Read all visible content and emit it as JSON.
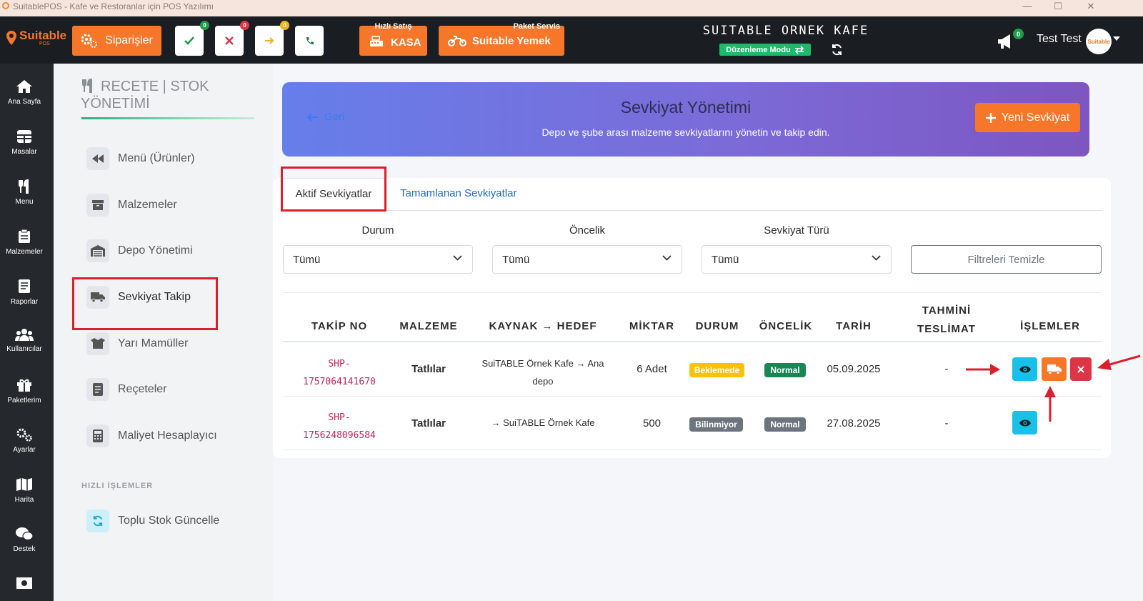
{
  "window": {
    "title": "SuitablePOS - Kafe ve Restoranlar için POS Yazılımı",
    "controls": [
      "—",
      "☐",
      "✕"
    ]
  },
  "topbar": {
    "logo_text": "Suitable",
    "logo_sub": "POS",
    "orders_label": "Siparişler",
    "status_buttons": [
      {
        "name": "approved",
        "badge": "0",
        "badge_color": "#1e9e4a",
        "icon_color": "#1e9e4a"
      },
      {
        "name": "cancelled",
        "badge": "0",
        "badge_color": "#dc3545",
        "icon_color": "#dc3545"
      },
      {
        "name": "forwarded",
        "badge": "0",
        "badge_color": "#f0b323",
        "icon_color": "#f0b323"
      },
      {
        "name": "phone",
        "badge": "",
        "badge_color": "",
        "icon_color": "#1e7b4a"
      }
    ],
    "quick_sale_label": "Hızlı Satış",
    "kasa_label": "KASA",
    "package_label": "Paket Servis",
    "suitable_yemek_label": "Suitable Yemek",
    "cafe_name": "SUITABLE ORNEK KAFE",
    "mode_label": "Düzenleme Modu",
    "notification_count": "0",
    "user_name": "Test Test",
    "avatar_text": "Suitable"
  },
  "sidebar": {
    "items": [
      {
        "label": "Ana Sayfa",
        "icon": "home-icon"
      },
      {
        "label": "Masalar",
        "icon": "table-icon"
      },
      {
        "label": "Menu",
        "icon": "utensils-icon"
      },
      {
        "label": "Malzemeler",
        "icon": "clipboard-icon"
      },
      {
        "label": "Raporlar",
        "icon": "report-icon"
      },
      {
        "label": "Kullanıcılar",
        "icon": "users-icon"
      },
      {
        "label": "Paketlerim",
        "icon": "gift-icon"
      },
      {
        "label": "Ayarlar",
        "icon": "gears-icon"
      },
      {
        "label": "Harita",
        "icon": "map-icon"
      },
      {
        "label": "Destek",
        "icon": "chat-icon"
      }
    ]
  },
  "left_panel": {
    "title_line1": "RECETE | STOK",
    "title_line2": "YÖNETİMİ",
    "items": [
      {
        "label": "Menü (Ürünler)",
        "icon": "backward-icon"
      },
      {
        "label": "Malzemeler",
        "icon": "box-icon"
      },
      {
        "label": "Depo Yönetimi",
        "icon": "warehouse-icon"
      },
      {
        "label": "Sevkiyat Takip",
        "icon": "truck-icon"
      },
      {
        "label": "Yarı Mamüller",
        "icon": "box-open-icon"
      },
      {
        "label": "Reçeteler",
        "icon": "recipe-icon"
      },
      {
        "label": "Maliyet Hesaplayıcı",
        "icon": "calculator-icon"
      }
    ],
    "quick_title": "HIZLI İŞLEMLER",
    "quick_item": "Toplu Stok Güncelle"
  },
  "hero": {
    "back_label": "Geri",
    "title": "Sevkiyat Yönetimi",
    "subtitle": "Depo ve şube arası malzeme sevkiyatlarını yönetin ve takip edin.",
    "new_button": "Yeni Sevkiyat"
  },
  "tabs": [
    {
      "label": "Aktif Sevkiyatlar",
      "active": true
    },
    {
      "label": "Tamamlanan Sevkiyatlar",
      "active": false
    }
  ],
  "filters": {
    "durum_label": "Durum",
    "durum_value": "Tümü",
    "oncelik_label": "Öncelik",
    "oncelik_value": "Tümü",
    "tur_label": "Sevkiyat Türü",
    "tur_value": "Tümü",
    "clear_label": "Filtreleri Temizle"
  },
  "table": {
    "headers": {
      "takip": "TAKİP NO",
      "malzeme": "MALZEME",
      "kaynak": "KAYNAK → HEDEF",
      "miktar": "MİKTAR",
      "durum": "DURUM",
      "oncelik": "ÖNCELİK",
      "tarih": "TARİH",
      "tahmini1": "TAHMİNİ",
      "tahmini2": "TESLİMAT",
      "islemler": "İŞLEMLER"
    },
    "rows": [
      {
        "takip_1": "SHP-",
        "takip_2": "1757064141670",
        "malzeme": "Tatlılar",
        "kaynak_1": "SuiTABLE Örnek Kafe",
        "kaynak_arrow": "→",
        "kaynak_2a": "Ana",
        "kaynak_2b": "depo",
        "miktar": "6 Adet",
        "durum": "Beklemede",
        "durum_color": "#ffc107",
        "oncelik": "Normal",
        "oncelik_color": "#198754",
        "tarih": "05.09.2025",
        "tahmini": "-"
      },
      {
        "takip_1": "SHP-",
        "takip_2": "1756248096584",
        "malzeme": "Tatlılar",
        "kaynak_arrow": "→",
        "kaynak_2": "SuiTABLE Örnek Kafe",
        "miktar": "500",
        "durum": "Bilinmiyor",
        "durum_color": "#6c757d",
        "oncelik": "Normal",
        "oncelik_color": "#6c757d",
        "tarih": "27.08.2025",
        "tahmini": "-"
      }
    ]
  },
  "colors": {
    "accent_orange": "#f6762a",
    "highlight_red": "#dc1e2e",
    "link_blue": "#1a6ad9",
    "view_cyan": "#17c1e8"
  }
}
